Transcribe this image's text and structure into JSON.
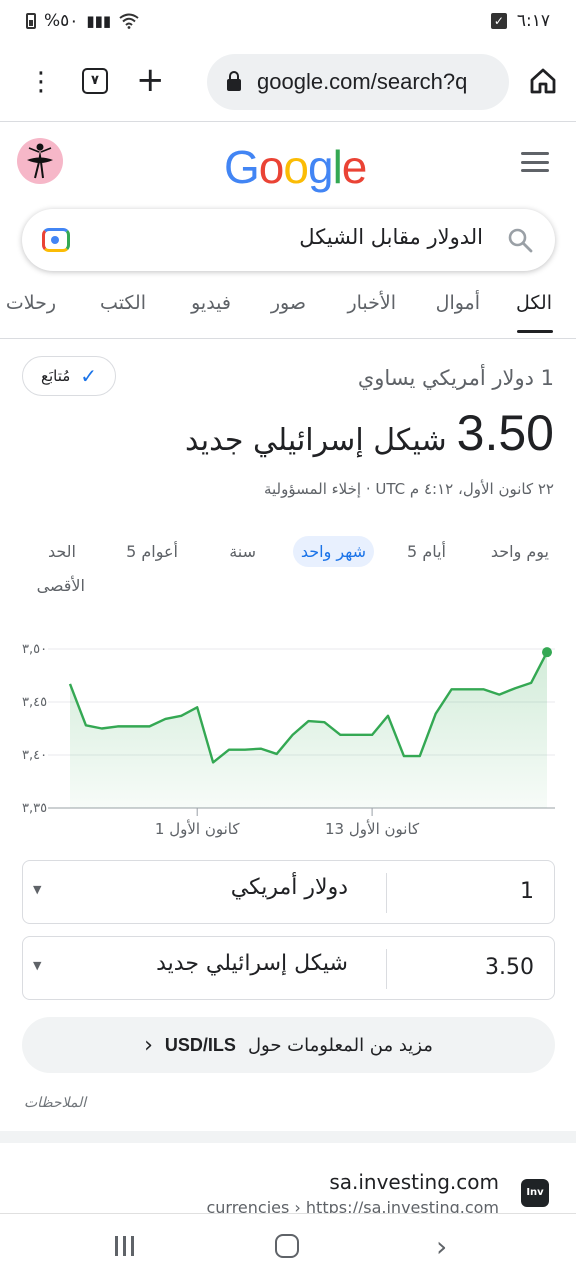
{
  "status_bar": {
    "time": "٦:١٧",
    "battery": "%٥٠"
  },
  "browser": {
    "tab_count": "٧",
    "url": "google.com/search?q"
  },
  "search": {
    "query": "الدولار مقابل الشيكل"
  },
  "tabs": [
    {
      "label": "الكل",
      "active": true
    },
    {
      "label": "أموال",
      "active": false
    },
    {
      "label": "الأخبار",
      "active": false
    },
    {
      "label": "صور",
      "active": false
    },
    {
      "label": "فيديو",
      "active": false
    },
    {
      "label": "الكتب",
      "active": false
    },
    {
      "label": "رحلات",
      "active": false
    }
  ],
  "result": {
    "follow_label": "مُتابَع",
    "equals_label": "1 دولار أمريكي يساوي",
    "value": "3.50",
    "value_unit": "شيكل إسرائيلي جديد",
    "time_note": "٢٢ كانون الأول، ٤:١٢ م UTC · إخلاء المسؤولية"
  },
  "ranges": [
    {
      "label": "يوم واحد",
      "active": false
    },
    {
      "label": "5 أيام",
      "active": false
    },
    {
      "label": "شهر واحد",
      "active": true
    },
    {
      "label": "سنة",
      "active": false
    },
    {
      "label": "5 أعوام",
      "active": false
    },
    {
      "label": "الحد",
      "active": false
    },
    {
      "label": "الأقصى",
      "active": false
    }
  ],
  "chart_data": {
    "type": "area",
    "ylim": [
      3.35,
      3.5
    ],
    "y_ticks": [
      "٣,٥٠",
      "٣,٤٥",
      "٣,٤٠",
      "٣,٣٥"
    ],
    "x_ticks": [
      "1 كانون الأول",
      "13 كانون الأول"
    ],
    "values": [
      3.467,
      3.428,
      3.425,
      3.427,
      3.427,
      3.427,
      3.434,
      3.437,
      3.445,
      3.393,
      3.405,
      3.405,
      3.406,
      3.401,
      3.419,
      3.432,
      3.431,
      3.419,
      3.419,
      3.419,
      3.437,
      3.399,
      3.399,
      3.439,
      3.462,
      3.462,
      3.462,
      3.457,
      3.463,
      3.468,
      3.497
    ],
    "colors": {
      "line": "#34a853",
      "fill": "#e6f4ea"
    }
  },
  "converter": {
    "from_amount": "1",
    "from_unit": "دولار أمريكي",
    "to_amount": "3.50",
    "to_unit": "شيكل إسرائيلي جديد"
  },
  "more_info": {
    "prefix": "مزيد من المعلومات حول",
    "pair": "USD/ILS"
  },
  "feedback": "الملاحظات",
  "next_result": {
    "site": "sa.investing.com",
    "url": "currencies › https://sa.investing.com",
    "favicon_text": "Inv"
  }
}
